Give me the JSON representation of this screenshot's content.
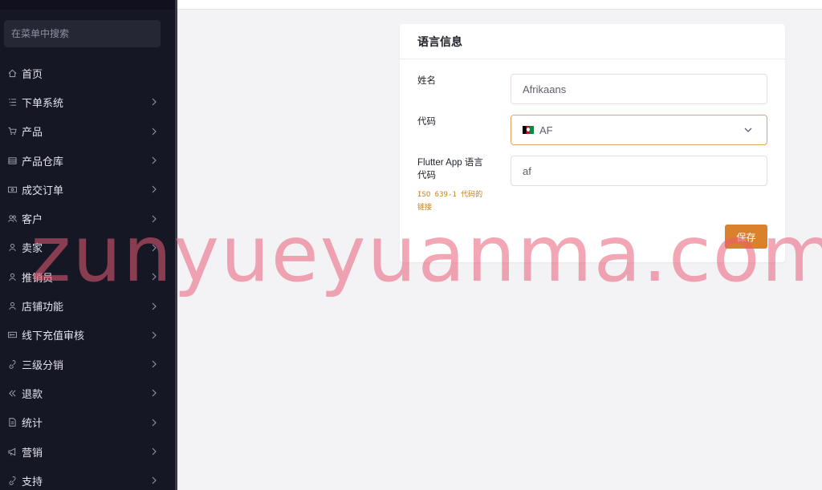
{
  "sidebar": {
    "search_placeholder": "在菜单中搜索",
    "items": [
      {
        "label": "首页",
        "icon": "home-icon"
      },
      {
        "label": "下单系统",
        "icon": "list-icon"
      },
      {
        "label": "产品",
        "icon": "cart-icon"
      },
      {
        "label": "产品仓库",
        "icon": "warehouse-icon"
      },
      {
        "label": "成交订单",
        "icon": "order-icon"
      },
      {
        "label": "客户",
        "icon": "users-icon"
      },
      {
        "label": "卖家",
        "icon": "user-icon"
      },
      {
        "label": "推销员",
        "icon": "salesman-icon"
      },
      {
        "label": "店铺功能",
        "icon": "store-icon"
      },
      {
        "label": "线下充值审核",
        "icon": "recharge-icon"
      },
      {
        "label": "三级分销",
        "icon": "link-icon"
      },
      {
        "label": "退款",
        "icon": "refund-icon"
      },
      {
        "label": "统计",
        "icon": "document-icon"
      },
      {
        "label": "营销",
        "icon": "megaphone-icon"
      },
      {
        "label": "支持",
        "icon": "support-link-icon"
      }
    ]
  },
  "card": {
    "title": "语言信息",
    "name_label": "姓名",
    "name_value": "Afrikaans",
    "code_label": "代码",
    "code_value": "AF",
    "flutter_label_line1": "Flutter App 语言",
    "flutter_label_line2": "代码",
    "flutter_value": "af",
    "hint_line1": "ISO 639-1 代码的",
    "hint_line2": "链接",
    "save_label": "保存"
  },
  "watermark": "zunyueyuanma.com",
  "colors": {
    "sidebar_bg": "#161725",
    "accent": "#d9822b",
    "hint": "#c77f1f"
  }
}
